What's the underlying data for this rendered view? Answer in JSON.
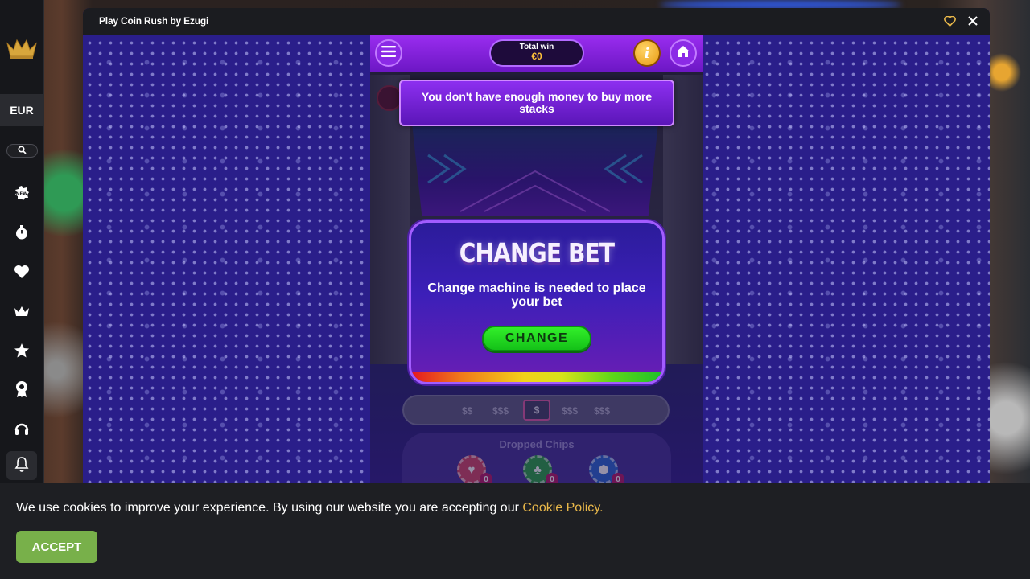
{
  "window": {
    "title": "Play Coin Rush by Ezugi"
  },
  "sidebar": {
    "currency": "EUR",
    "icons": [
      "crown-logo-icon",
      "search-icon",
      "new-badge-icon",
      "stopwatch-icon",
      "heart-icon",
      "crown-icon",
      "star-icon",
      "award-icon",
      "headset-icon",
      "bell-icon"
    ]
  },
  "game": {
    "total_win_label": "Total win",
    "total_win_value": "€0",
    "info_label": "i",
    "toast": "You don't have enough money to buy more stacks",
    "modal": {
      "title": "CHANGE BET",
      "message": "Change machine is needed to place your bet",
      "button": "CHANGE"
    },
    "bet_options": [
      "$$",
      "$$$",
      "$",
      "$$$",
      "$$$"
    ],
    "dropped_chips_label": "Dropped Chips",
    "chip_counts": [
      "0",
      "0",
      "0"
    ]
  },
  "cookie": {
    "text": "We use cookies to improve your experience. By using our website you are accepting our",
    "link": "Cookie Policy.",
    "accept": "ACCEPT"
  },
  "colors": {
    "accent_gold": "#e9b84a",
    "accept_green": "#78b04a",
    "game_purple": "#6c17c4"
  }
}
